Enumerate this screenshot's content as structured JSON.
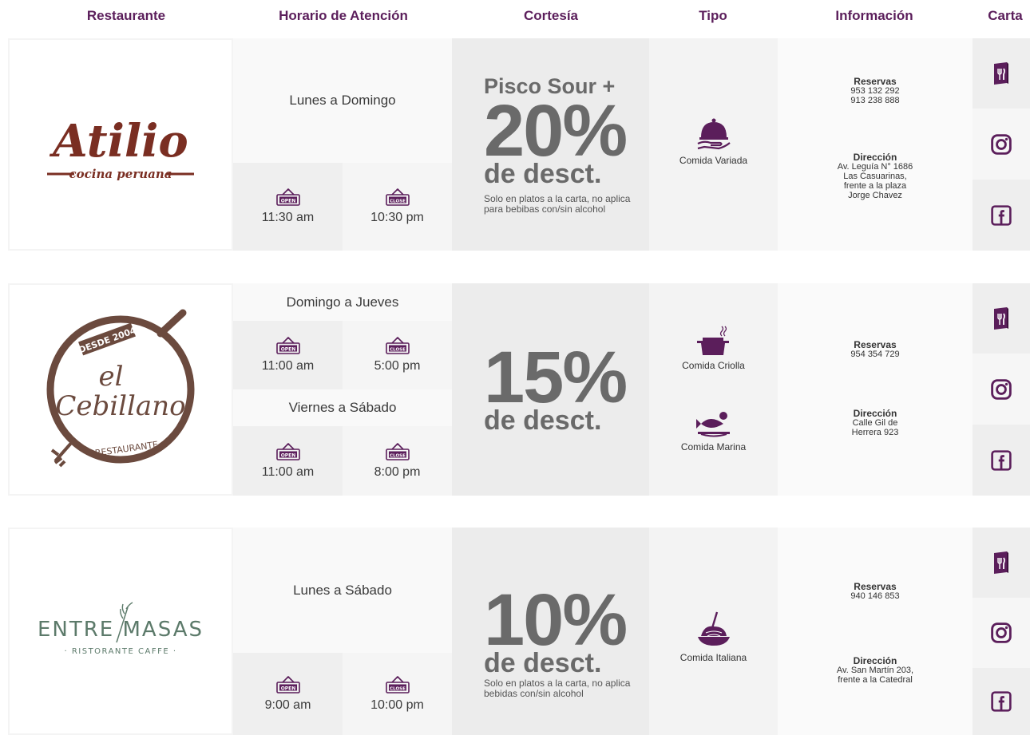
{
  "headers": [
    "Restaurante",
    "Horario de Atención",
    "Cortesía",
    "Tipo",
    "Información",
    "Carta"
  ],
  "restaurants": [
    {
      "logo": {
        "name": "Atilio",
        "tagline": "cocina peruana"
      },
      "days": "Lunes a Domingo",
      "open": "11:30 am",
      "close": "10:30 pm",
      "court_pre": "Pisco Sour +",
      "court_pct": "20%",
      "court_desc": "de desct.",
      "court_note": "Solo en platos a la carta, no aplica para bebibas con/sin alcohol",
      "tipos": [
        "Comida Variada"
      ],
      "res_label": "Reservas",
      "res_phones": [
        "953 132 292",
        "913 238 888"
      ],
      "dir_label": "Dirección",
      "dir_lines": [
        "Av. Leguía N° 1686",
        "Las Casuarinas,",
        "frente a la plaza",
        "Jorge Chavez"
      ]
    },
    {
      "logo": {
        "top": "DESDE 2004",
        "name1": "el",
        "name2": "Cebillano",
        "bottom": "RESTAURANTE"
      },
      "sched1_days": "Domingo a Jueves",
      "sched1_open": "11:00 am",
      "sched1_close": "5:00 pm",
      "sched2_days": "Viernes a Sábado",
      "sched2_open": "11:00 am",
      "sched2_close": "8:00 pm",
      "court_pct": "15%",
      "court_desc": "de desct.",
      "tipos": [
        "Comida Criolla",
        "Comida Marina"
      ],
      "res_label": "Reservas",
      "res_phones": [
        "954 354 729"
      ],
      "dir_label": "Dirección",
      "dir_lines": [
        "Calle Gil de",
        "Herrera 923"
      ]
    },
    {
      "logo": {
        "name": "ENTRE MASAS",
        "tagline": "· RISTORANTE CAFFE ·"
      },
      "days": "Lunes a Sábado",
      "open": "9:00 am",
      "close": "10:00 pm",
      "court_pct": "10%",
      "court_desc": "de desct.",
      "court_note": "Solo en platos a la carta, no aplica bebidas con/sin alcohol",
      "tipos": [
        "Comida Italiana"
      ],
      "res_label": "Reservas",
      "res_phones": [
        "940 146 853"
      ],
      "dir_label": "Dirección",
      "dir_lines": [
        "Av. San Martín 203,",
        "frente a la Catedral"
      ]
    }
  ],
  "signs": {
    "open": "OPEN",
    "close": "CLOSE"
  },
  "icons": {
    "carta": [
      "menu-icon",
      "instagram-icon",
      "facebook-icon"
    ]
  },
  "colors": {
    "brand": "#5b1e5b",
    "atilio": "#7a2e22",
    "cebillano": "#6b4a3e",
    "entremasas": "#5c7a6a"
  }
}
